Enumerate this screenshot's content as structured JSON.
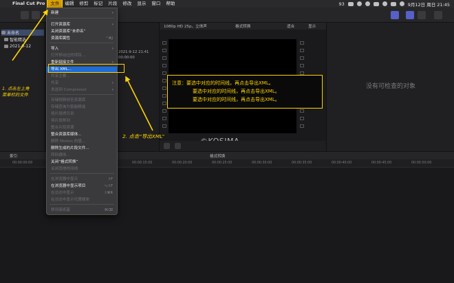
{
  "menubar": {
    "app": "Final Cut Pro",
    "items": [
      "文件",
      "编辑",
      "修剪",
      "标记",
      "片段",
      "修改",
      "显示",
      "窗口",
      "帮助"
    ],
    "battery": "93",
    "datetime": "9月12日 周日 21:45"
  },
  "browser": {
    "rows": [
      "未命名",
      "智能精选",
      "2021-9-12"
    ]
  },
  "clips": {
    "lines": [
      "2021-9-12 21:41",
      "00:00:00"
    ]
  },
  "viewer": {
    "format": "1080p HD 25p，立体声",
    "title": "格式转换",
    "zoom": "适合",
    "display": "显示"
  },
  "note": {
    "lines": [
      "注意：要选中对应的时间线，再点击导出XML。",
      "要选中对应的时间线，再点击导出XML。",
      "要选中对应的时间线，再点击导出XML。"
    ]
  },
  "watermark": "©KOSIMA",
  "inspector": {
    "empty": "没有可检查的对象"
  },
  "timeline": {
    "index": "索引",
    "name": "格式转换",
    "ticks": [
      "00:00:00:00",
      "00:00:05:00",
      "00:00:10:00",
      "00:00:15:00",
      "00:00:20:00",
      "00:00:25:00",
      "00:00:30:00",
      "00:00:35:00",
      "00:00:40:00",
      "00:00:45:00",
      "00:00:50:00"
    ]
  },
  "file_menu": {
    "items": [
      {
        "label": "新建",
        "enabled": true,
        "submenu": true
      },
      {
        "label": "打开资源库",
        "enabled": true,
        "submenu": true
      },
      {
        "label": "关闭资源库“未命名”",
        "enabled": true
      },
      {
        "label": "资源库属性",
        "enabled": true,
        "shortcut": "⌃⌘J"
      },
      {
        "label": "导入",
        "enabled": true,
        "submenu": true
      },
      {
        "label": "打开移动过的项目...",
        "enabled": false
      },
      {
        "label": "重新链接文件",
        "enabled": true,
        "submenu": true
      },
      {
        "label": "导出 XML...",
        "enabled": true,
        "highlighted": true
      },
      {
        "label": "共享主要...",
        "enabled": false
      },
      {
        "label": "共享",
        "enabled": false,
        "submenu": true
      },
      {
        "label": "发送到 Compressor",
        "enabled": false,
        "submenu": true
      },
      {
        "label": "存储视频帧至资源库",
        "enabled": false
      },
      {
        "label": "存储查询为智能精选",
        "enabled": false
      },
      {
        "label": "将片段拷贝到",
        "enabled": false
      },
      {
        "label": "将片段移到",
        "enabled": false
      },
      {
        "label": "整合片段资源",
        "enabled": false
      },
      {
        "label": "整合资源库媒体...",
        "enabled": true
      },
      {
        "label": "删除 Motion 的值...",
        "enabled": false
      },
      {
        "label": "删除生成的片段文件...",
        "enabled": true
      },
      {
        "label": "转码媒体...",
        "enabled": false
      },
      {
        "label": "关闭“格式转换”",
        "enabled": true
      },
      {
        "label": "关闭其他时间线",
        "enabled": false
      },
      {
        "label": "在浏览器中显示",
        "enabled": false,
        "shortcut": "⇧F"
      },
      {
        "label": "在浏览器中显示项目",
        "enabled": true,
        "shortcut": "⌥⇧F"
      },
      {
        "label": "在访达中显示",
        "enabled": false,
        "shortcut": "⇧⌘R"
      },
      {
        "label": "在访达中显示代理媒体",
        "enabled": false
      },
      {
        "label": "移到废纸篓",
        "enabled": false,
        "shortcut": "⌘⌫"
      }
    ]
  },
  "annotations": {
    "step1": [
      "1. 点击左上角",
      "菜单栏的文件"
    ],
    "step2": "2. 点击“导出XML”"
  },
  "colors": {
    "annotation": "#ffd400",
    "menu_highlight": "#1f6dd6"
  }
}
